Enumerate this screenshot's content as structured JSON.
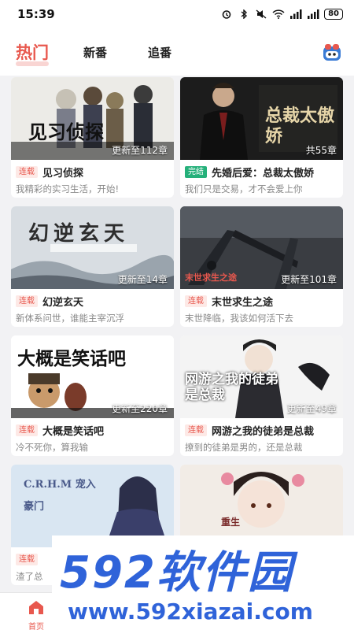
{
  "status": {
    "time": "15:39",
    "battery": "80"
  },
  "tabs": [
    {
      "label": "热门",
      "active": true
    },
    {
      "label": "新番",
      "active": false
    },
    {
      "label": "追番",
      "active": false
    }
  ],
  "cards": [
    {
      "cover_title": "见习侦探",
      "update": "更新至112章",
      "badge": "连载",
      "badge_type": "ongoing",
      "title": "见习侦探",
      "desc": "我精彩的实习生活，开始!"
    },
    {
      "cover_title": "总裁太傲娇",
      "update": "共55章",
      "badge": "完结",
      "badge_type": "done",
      "title": "先婚后爱：总裁太傲娇",
      "desc": "我们只是交易，才不会爱上你"
    },
    {
      "cover_title": "幻逆玄天",
      "update": "更新至14章",
      "badge": "连载",
      "badge_type": "ongoing",
      "title": "幻逆玄天",
      "desc": "新体系问世，谁能主宰沉浮"
    },
    {
      "cover_title": "末世求生之途",
      "update": "更新至101章",
      "badge": "连载",
      "badge_type": "ongoing",
      "title": "末世求生之途",
      "desc": "末世降临，我该如何活下去"
    },
    {
      "cover_title": "大概是笑话吧",
      "update": "更新至220章",
      "badge": "连载",
      "badge_type": "ongoing",
      "title": "大概是笑话吧",
      "desc": "冷不死你，算我输"
    },
    {
      "cover_title": "网游之我的徒弟是总裁",
      "update": "更新至49章",
      "badge": "连载",
      "badge_type": "ongoing",
      "title": "网游之我的徒弟是总裁",
      "desc": "撩到的徒弟是男的，还是总裁"
    },
    {
      "cover_title": "C.R.H.M 宠入豪门",
      "update": "",
      "badge": "连载",
      "badge_type": "ongoing",
      "title": "",
      "desc": "渣了总"
    },
    {
      "cover_title": "重生",
      "update": "",
      "badge": "",
      "badge_type": "",
      "title": "",
      "desc": ""
    }
  ],
  "bottom_nav": {
    "home_label": "首页"
  },
  "watermark": {
    "brand": "592软件园",
    "url": "www.592xiazai.com"
  },
  "colors": {
    "accent": "#e8584e",
    "done": "#25b07a",
    "watermark_blue": "#2f63d9"
  }
}
